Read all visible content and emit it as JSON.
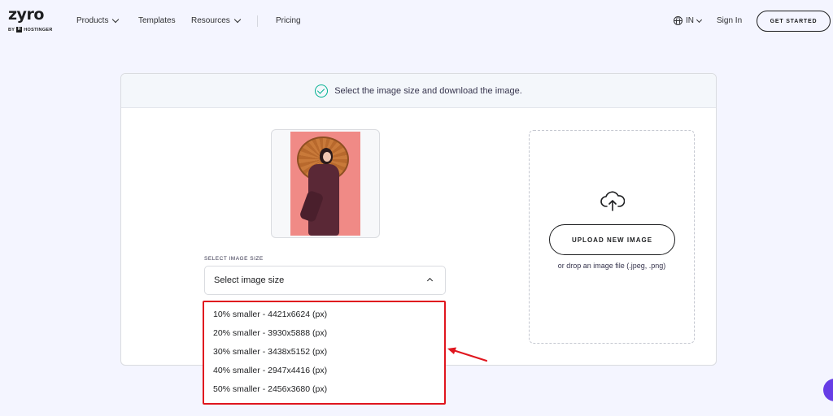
{
  "logo": {
    "word": "zyro",
    "sub_prefix": "BY",
    "sub_brand": "HOSTINGER"
  },
  "nav": {
    "products": "Products",
    "templates": "Templates",
    "resources": "Resources",
    "pricing": "Pricing",
    "language": "IN",
    "sign_in": "Sign In",
    "get_started": "GET STARTED"
  },
  "banner": {
    "text": "Select the image size and download the image."
  },
  "size_select": {
    "label": "SELECT IMAGE SIZE",
    "placeholder": "Select image size",
    "options": [
      "10% smaller - 4421x6624 (px)",
      "20% smaller - 3930x5888 (px)",
      "30% smaller - 3438x5152 (px)",
      "40% smaller - 2947x4416 (px)",
      "50% smaller - 2456x3680 (px)"
    ]
  },
  "upload": {
    "button": "UPLOAD NEW IMAGE",
    "drop_text": "or drop an image file (.jpeg, .png)"
  },
  "colors": {
    "accent_green": "#00b090",
    "highlight_red": "#e0161e",
    "chat_purple": "#673de6",
    "background": "#f4f5ff"
  },
  "icons": [
    "globe-icon",
    "check-circle-icon",
    "cloud-upload-icon",
    "chevron-up-icon",
    "chevron-down-icon"
  ]
}
